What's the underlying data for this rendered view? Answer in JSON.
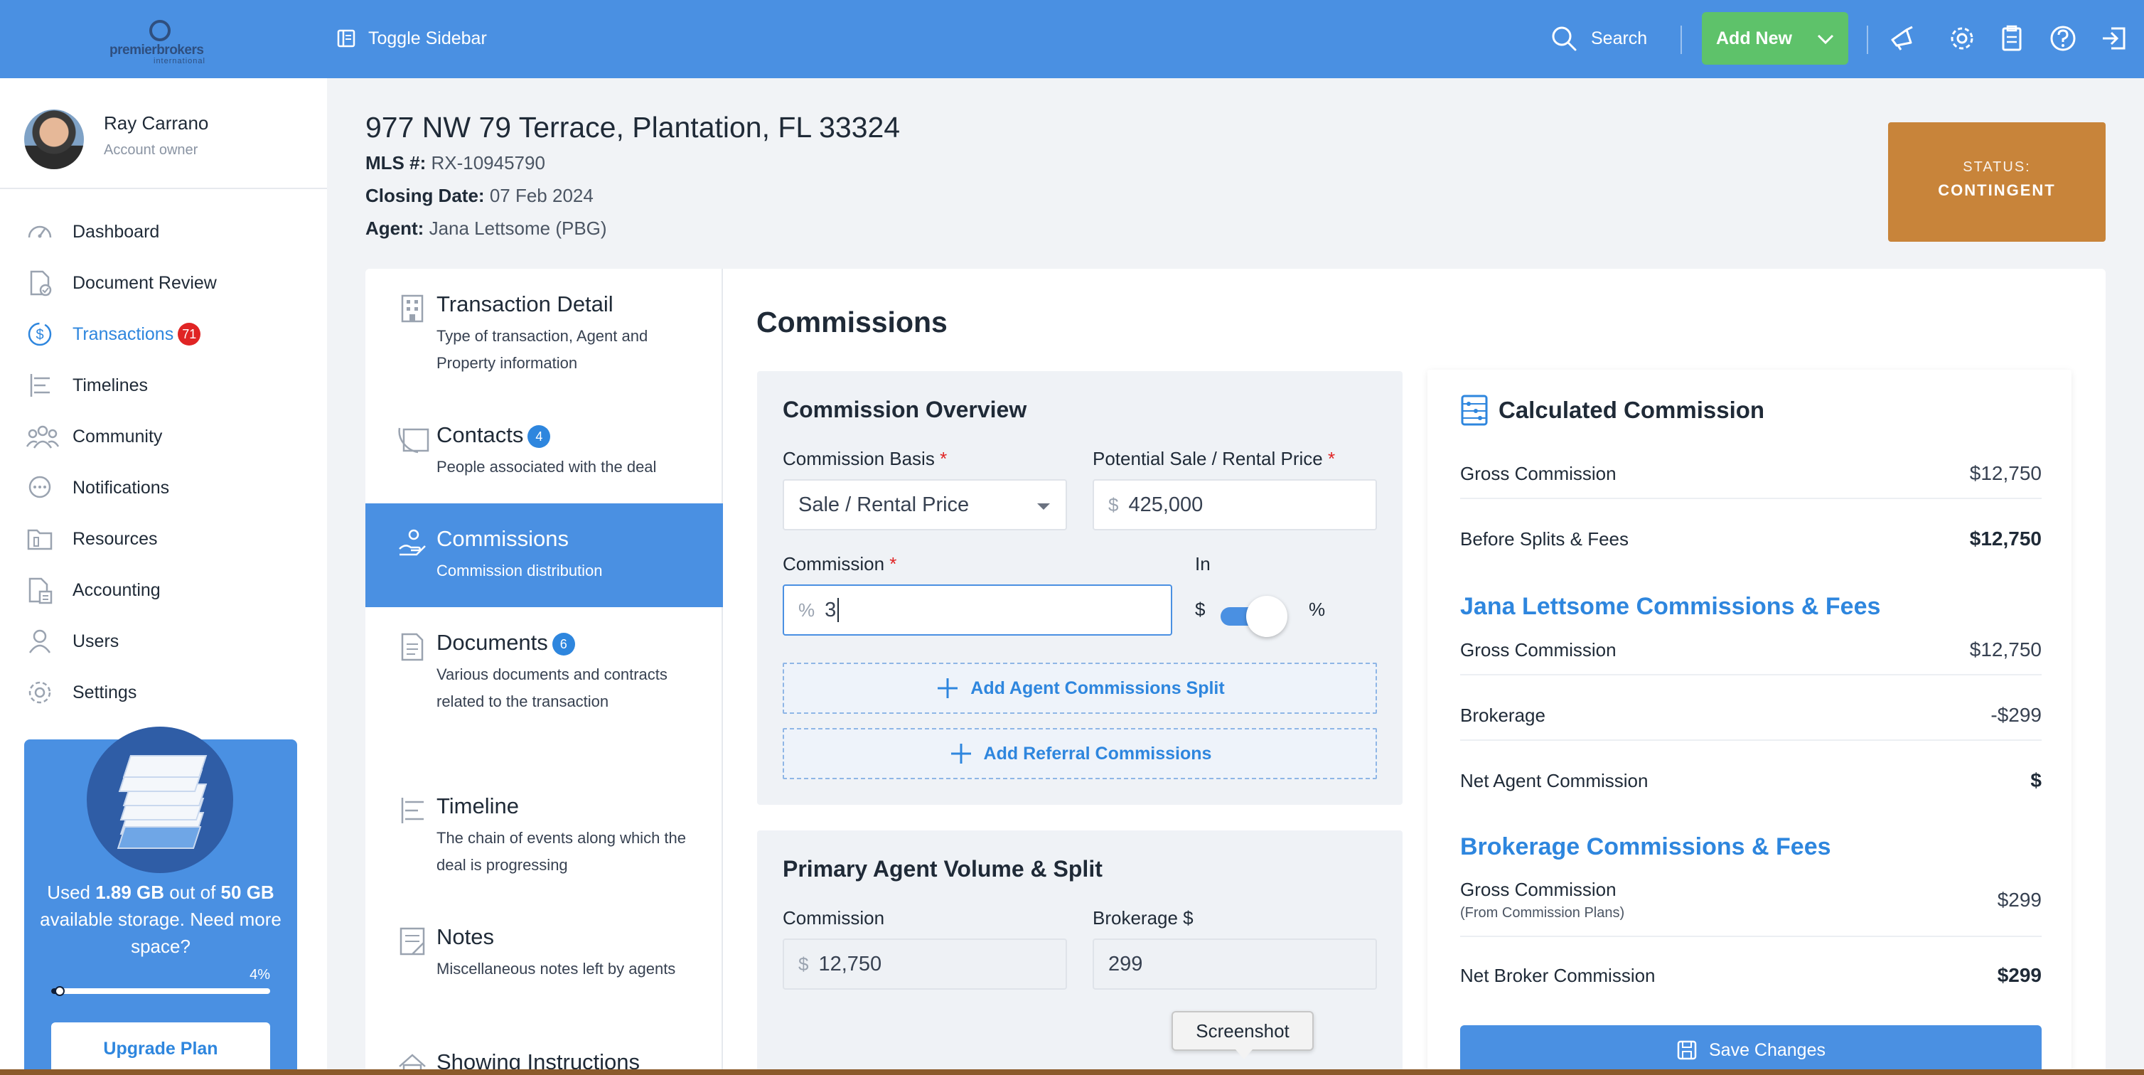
{
  "topbar": {
    "logo_word": "premierbrokers",
    "logo_sub": "international",
    "toggle_sidebar": "Toggle Sidebar",
    "search": "Search",
    "add_new": "Add New"
  },
  "user": {
    "name": "Ray Carrano",
    "role": "Account owner"
  },
  "nav": [
    {
      "label": "Dashboard",
      "icon": "gauge-icon"
    },
    {
      "label": "Document Review",
      "icon": "doc-check-icon"
    },
    {
      "label": "Transactions",
      "icon": "dollar-cycle-icon",
      "badge": "71",
      "active": true
    },
    {
      "label": "Timelines",
      "icon": "timeline-icon"
    },
    {
      "label": "Community",
      "icon": "community-icon"
    },
    {
      "label": "Notifications",
      "icon": "chat-icon"
    },
    {
      "label": "Resources",
      "icon": "folder-icon"
    },
    {
      "label": "Accounting",
      "icon": "calculator-icon"
    },
    {
      "label": "Users",
      "icon": "user-icon"
    },
    {
      "label": "Settings",
      "icon": "gear-icon"
    }
  ],
  "storage": {
    "used_prefix": "Used ",
    "used": "1.89 GB",
    "mid": " out of ",
    "total": "50 GB",
    "suffix": " available storage. Need more space?",
    "percent_label": "4%",
    "percent_value": 4,
    "upgrade": "Upgrade Plan"
  },
  "header": {
    "address": "977 NW 79 Terrace, Plantation, FL 33324",
    "mls_label": "MLS #:",
    "mls": "RX-10945790",
    "closing_label": "Closing Date:",
    "closing": "07 Feb 2024",
    "agent_label": "Agent:",
    "agent": "Jana Lettsome (PBG)",
    "status_label": "STATUS:",
    "status": "CONTINGENT",
    "status_color": "#c8843a"
  },
  "steps": [
    {
      "title": "Transaction Detail",
      "desc": "Type of transaction, Agent and Property information",
      "icon": "building-icon"
    },
    {
      "title": "Contacts",
      "badge": "4",
      "desc": "People associated with the deal",
      "icon": "contacts-icon"
    },
    {
      "title": "Commissions",
      "desc": "Commission distribution",
      "icon": "hand-coins-icon",
      "active": true
    },
    {
      "title": "Documents",
      "badge": "6",
      "desc": "Various documents and contracts related to the transaction",
      "icon": "document-icon"
    },
    {
      "title": "Timeline",
      "desc": "The chain of events along which the deal is progressing",
      "icon": "timeline-icon"
    },
    {
      "title": "Notes",
      "desc": "Miscellaneous notes left by agents",
      "icon": "notes-icon"
    },
    {
      "title": "Showing Instructions",
      "desc": "",
      "icon": "house-icon"
    }
  ],
  "commissions": {
    "title": "Commissions",
    "overview_title": "Commission Overview",
    "basis_label": "Commission Basis",
    "basis_value": "Sale / Rental Price",
    "price_label": "Potential Sale / Rental Price",
    "price_prefix": "$",
    "price_value": "425,000",
    "commission_label": "Commission",
    "commission_prefix": "%",
    "commission_value": "3",
    "in_label": "In",
    "toggle_left": "$",
    "toggle_right": "%",
    "add_split": "Add Agent Commissions Split",
    "add_referral": "Add Referral Commissions",
    "primary_title": "Primary Agent Volume & Split",
    "p_commission_label": "Commission",
    "p_commission_prefix": "$",
    "p_commission_value": "12,750",
    "p_brokerage_label": "Brokerage $",
    "p_brokerage_value": "299"
  },
  "calc": {
    "title": "Calculated Commission",
    "gross_label": "Gross Commission",
    "gross": "$12,750",
    "before_label": "Before Splits & Fees",
    "before": "$12,750",
    "agent_heading": "Jana Lettsome Commissions & Fees",
    "a_gross_label": "Gross Commission",
    "a_gross": "$12,750",
    "a_brokerage_label": "Brokerage",
    "a_brokerage": "-$299",
    "a_net_label": "Net Agent Commission",
    "a_net": "$",
    "broker_heading": "Brokerage Commissions & Fees",
    "b_gross_label": "Gross Commission",
    "b_gross_note": "(From Commission Plans)",
    "b_gross": "$299",
    "b_net_label": "Net Broker Commission",
    "b_net": "$299",
    "save": "Save Changes"
  },
  "tooltip": "Screenshot"
}
